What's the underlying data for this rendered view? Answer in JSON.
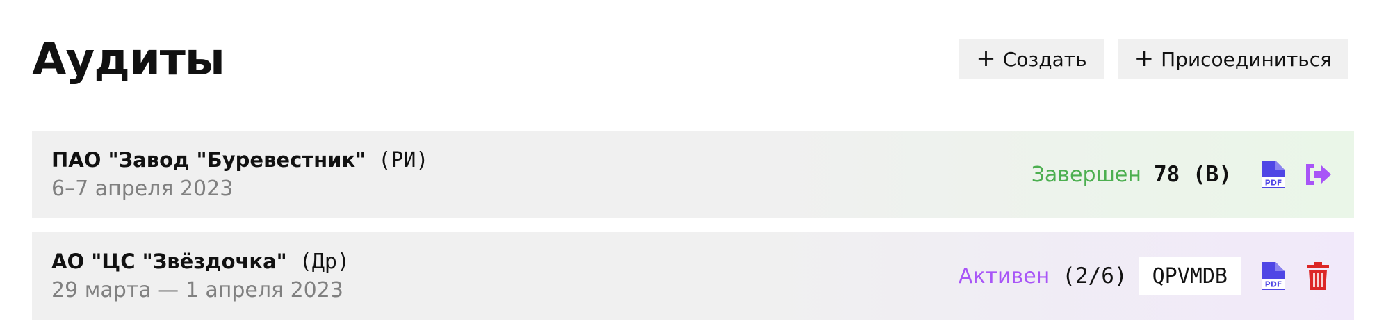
{
  "header": {
    "title": "Аудиты",
    "create_label": "Создать",
    "join_label": "Присоединиться",
    "plus_symbol": "+"
  },
  "audits": [
    {
      "name": "ПАО \"Завод \"Буревестник\"",
      "code": "(РИ)",
      "dates": "6–7 апреля 2023",
      "status": "Завершен",
      "score": "78 (B)",
      "status_color": "#4caf50",
      "actions": [
        "pdf-icon",
        "exit-icon"
      ]
    },
    {
      "name": "АО \"ЦС \"Звёздочка\"",
      "code": "(Др)",
      "dates": "29 марта — 1 апреля 2023",
      "status": "Активен",
      "progress": "(2/6)",
      "join_code": "QPVMDB",
      "status_color": "#a855f7",
      "actions": [
        "pdf-icon",
        "trash-icon"
      ]
    }
  ],
  "colors": {
    "pdf_icon": "#4f46e5",
    "exit_icon": "#a855f7",
    "trash_icon": "#dc2626",
    "card_bg": "#f0f0f0",
    "done_tint": "#eaf6e8",
    "active_tint": "#f1e9fa"
  }
}
